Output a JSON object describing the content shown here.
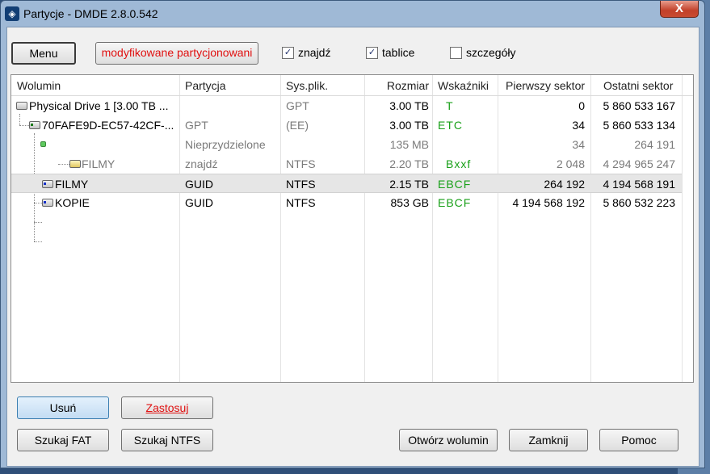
{
  "window": {
    "title": "Partycje - DMDE 2.8.0.542",
    "close_label": "X"
  },
  "toolbar": {
    "menu_label": "Menu",
    "modified_label": "modyfikowane partycjonowani",
    "find_label": "znajdź",
    "find_checked": true,
    "tables_label": "tablice",
    "tables_checked": true,
    "details_label": "szczegóły",
    "details_checked": false,
    "check_mark": "✓"
  },
  "columns": [
    "Wolumin",
    "Partycja",
    "Sys.plik.",
    "Rozmiar",
    "Wskaźniki",
    "Pierwszy sektor",
    "Ostatni sektor"
  ],
  "rows": [
    {
      "name": "Physical Drive 1 [3.00 TB ...",
      "partition": "",
      "fs": "GPT",
      "size": "3.00 TB",
      "flags": "T",
      "first": "0",
      "last": "5 860 533 167",
      "icon": "hard-drive-icon"
    },
    {
      "name": "70FAFE9D-EC57-42CF-...",
      "partition": "GPT",
      "fs": "(EE)",
      "size": "3.00 TB",
      "flags": "ETC",
      "first": "34",
      "last": "5 860 533 134",
      "icon": "gpt-disk-icon"
    },
    {
      "name": "",
      "partition": "Nieprzydzielone",
      "fs": "",
      "size": "135 MB",
      "flags": "",
      "first": "34",
      "last": "264 191",
      "icon": "unallocated-icon"
    },
    {
      "name": "FILMY",
      "partition": "znajdź",
      "fs": "NTFS",
      "size": "2.20 TB",
      "flags": "Bxxf",
      "first": "2 048",
      "last": "4 294 965 247",
      "icon": "found-volume-icon"
    },
    {
      "name": "FILMY",
      "partition": "GUID",
      "fs": "NTFS",
      "size": "2.15 TB",
      "flags": "EBCF",
      "first": "264 192",
      "last": "4 194 568 191",
      "icon": "volume-icon"
    },
    {
      "name": "KOPIE",
      "partition": "GUID",
      "fs": "NTFS",
      "size": "853 GB",
      "flags": "EBCF",
      "first": "4 194 568 192",
      "last": "5 860 532 223",
      "icon": "volume-icon"
    }
  ],
  "buttons": {
    "delete": "Usuń",
    "apply": "Zastosuj",
    "search_fat": "Szukaj FAT",
    "search_ntfs": "Szukaj NTFS",
    "open_volume": "Otwórz wolumin",
    "close": "Zamknij",
    "help": "Pomoc"
  },
  "colors": {
    "accent_red": "#e01010",
    "flag_green": "#19a019",
    "selected_button": "#cfe3f7"
  }
}
